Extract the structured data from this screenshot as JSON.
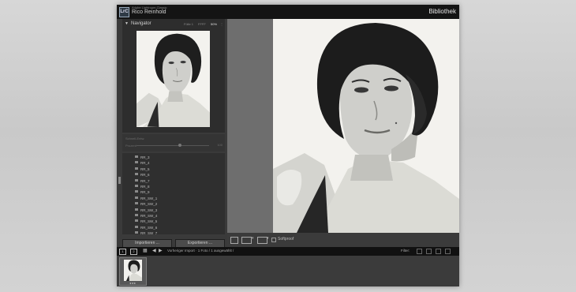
{
  "app": {
    "subtitle": "Adobe Lightroom Classic",
    "user": "Rico Reinhold",
    "module": "Bibliothek",
    "logo": "LrC"
  },
  "navigator": {
    "title": "Navigator",
    "zoom_levels": [
      "Fülle 1",
      "FFFF",
      "50%",
      "⋮"
    ],
    "active_zoom": "50%"
  },
  "collapsed_panel": {
    "title": "Schnell-Entw.",
    "slider_label": "Prozent",
    "slider_value": "100",
    "slider_fraction": 0.6
  },
  "folders": [
    "RR_3",
    "RR_4",
    "RR_5",
    "RR_6",
    "RR_7",
    "RR_8",
    "RR_9",
    "RR_SW_1",
    "RR_SW_2",
    "RR_SW_3",
    "RR_SW_4",
    "RR_SW_5",
    "RR_SW_6",
    "RR_SW_7",
    "RR_SW_SONST"
  ],
  "buttons": {
    "import": "Importieren ...",
    "export": "Exportieren ..."
  },
  "toolbar": {
    "softproof_label": "Softproof"
  },
  "filmbar": {
    "screen1": "1",
    "screen2": "2",
    "source": "Vorheriger Import · 1 Foto / 1 ausgewählt /",
    "filter_label": "Filter:"
  },
  "filmstrip": {
    "stars": "★★★"
  },
  "colors": {
    "titlebar": "#141414",
    "panel": "#3a3a3a",
    "accent": "#e6e6e6"
  }
}
